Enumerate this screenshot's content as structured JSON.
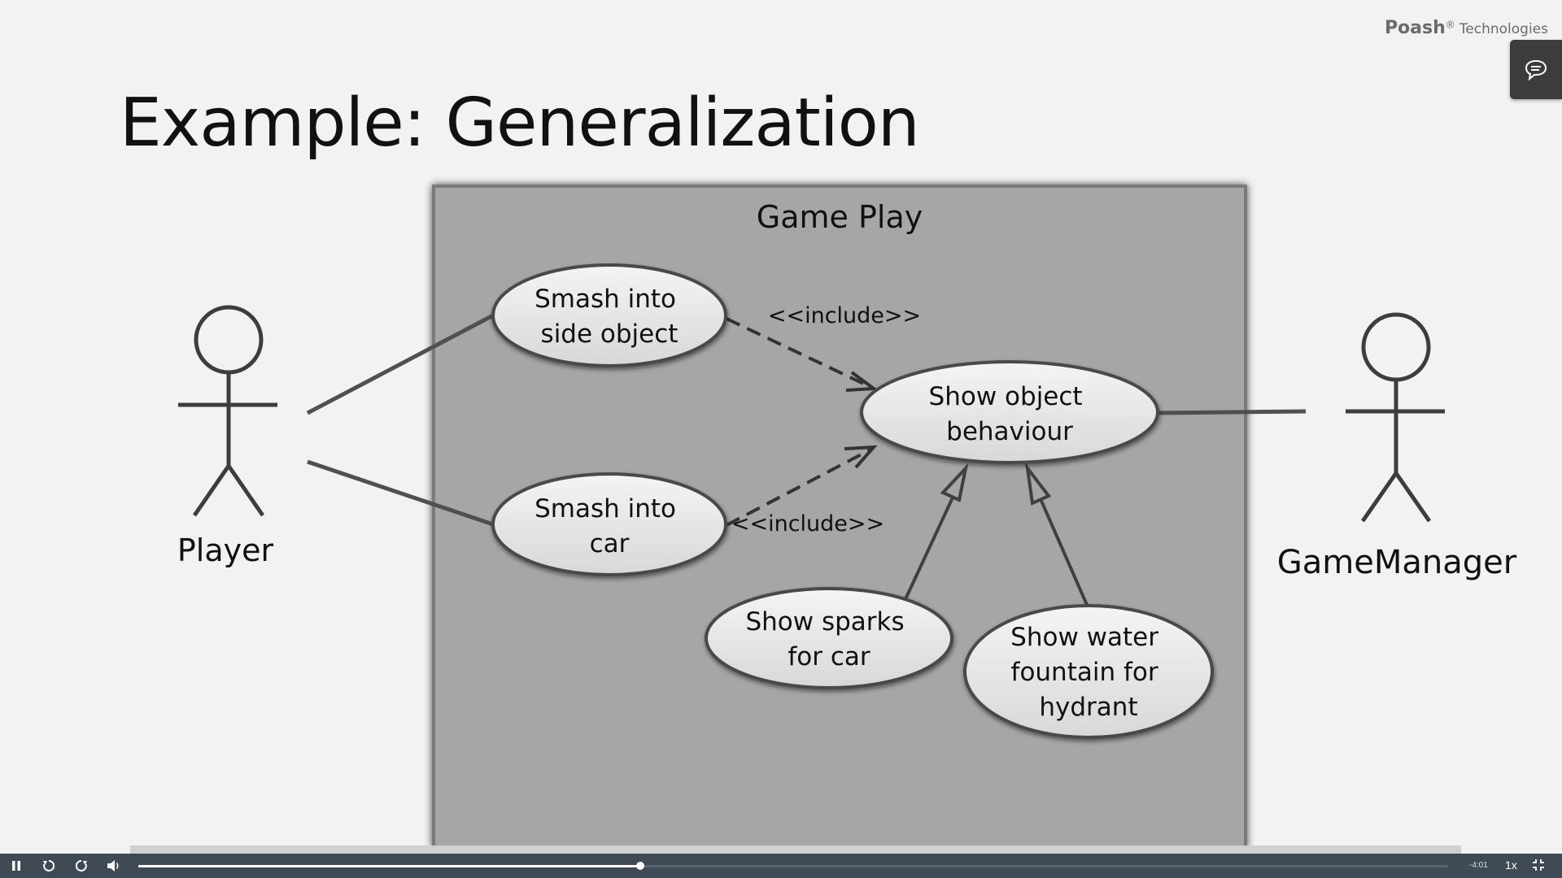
{
  "brand": {
    "name": "Poash",
    "reg": "®",
    "tech": "Technologies"
  },
  "slide": {
    "title": "Example: Generalization"
  },
  "diagram": {
    "system_label": "Game Play",
    "actors": {
      "player": "Player",
      "game_manager": "GameManager"
    },
    "use_cases": {
      "smash_side": [
        "Smash into",
        "side object"
      ],
      "smash_car": [
        "Smash into",
        "car"
      ],
      "show_behaviour": [
        "Show object",
        "behaviour"
      ],
      "show_sparks": [
        "Show sparks",
        "for car"
      ],
      "show_water": [
        "Show water",
        "fountain for",
        "hydrant"
      ]
    },
    "include_label_1": "<<include>>",
    "include_label_2": "<<include>>"
  },
  "player": {
    "time": "-4:01",
    "speed": "1x",
    "progress_percent": 38.3
  },
  "colors": {
    "system_fill": "#a6a6a6",
    "player_bar": "#3f4a55",
    "line": "#505050"
  },
  "icons": [
    "chat-icon",
    "pause-icon",
    "rewind-icon",
    "forward-icon",
    "volume-icon",
    "exit-fullscreen-icon"
  ]
}
